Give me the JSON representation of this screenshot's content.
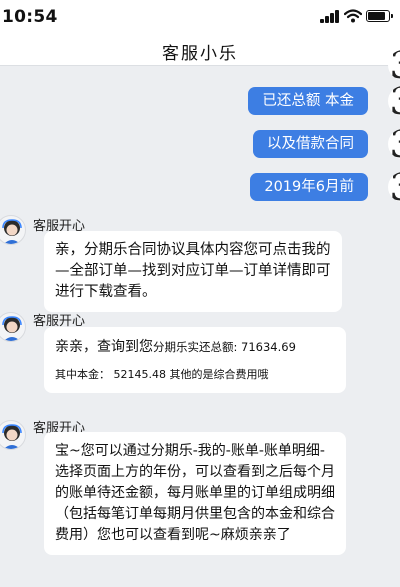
{
  "status_bar": {
    "time": "10:54"
  },
  "header": {
    "title": "客服小乐"
  },
  "user_messages": [
    {
      "text": "已还总额 本金"
    },
    {
      "text": "以及借款合同"
    },
    {
      "text": "2019年6月前"
    }
  ],
  "agent": {
    "name": "客服开心",
    "messages": [
      {
        "text": "亲，分期乐合同协议具体内容您可点击我的—全部订单—找到对应订单—订单详情即可进行下载查看。"
      },
      {
        "line1_prefix": "亲亲，查询到您",
        "line1_detail": "分期乐实还总额: 71634.69",
        "line2": "其中本金：  52145.48  其他的是综合费用哦"
      },
      {
        "text": "宝~您可以通过分期乐-我的-账单-账单明细-选择页面上方的年份，可以查看到之后每个月的账单待还金额，每月账单里的订单组成明细（包括每笔订单每期月供里包含的本金和综合费用）您也可以查看到呢~麻烦亲亲了"
      }
    ]
  },
  "colors": {
    "user_bubble": "#3d7ee3",
    "background": "#eceef1",
    "agent_bubble": "#ffffff"
  }
}
